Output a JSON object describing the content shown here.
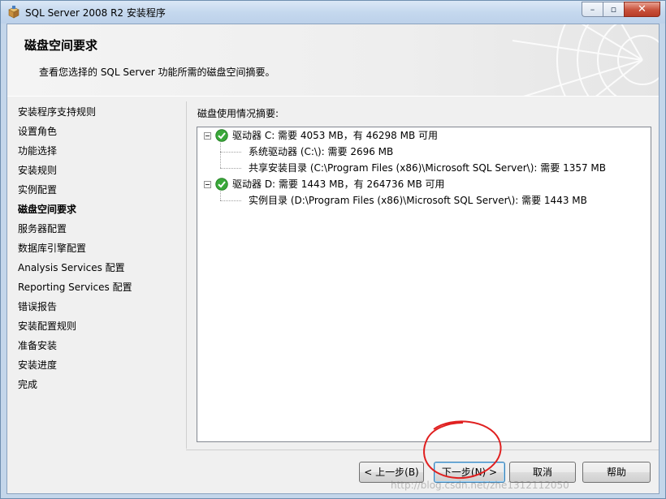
{
  "window": {
    "title": "SQL Server 2008 R2 安装程序",
    "caption_buttons": {
      "minimize": "–",
      "maximize": "▫",
      "close": "✕"
    }
  },
  "header": {
    "title": "磁盘空间要求",
    "subtitle": "查看您选择的 SQL Server 功能所需的磁盘空间摘要。"
  },
  "nav": {
    "items": [
      {
        "label": "安装程序支持规则",
        "active": false
      },
      {
        "label": "设置角色",
        "active": false
      },
      {
        "label": "功能选择",
        "active": false
      },
      {
        "label": "安装规则",
        "active": false
      },
      {
        "label": "实例配置",
        "active": false
      },
      {
        "label": "磁盘空间要求",
        "active": true
      },
      {
        "label": "服务器配置",
        "active": false
      },
      {
        "label": "数据库引擎配置",
        "active": false
      },
      {
        "label": "Analysis Services 配置",
        "active": false
      },
      {
        "label": "Reporting Services 配置",
        "active": false
      },
      {
        "label": "错误报告",
        "active": false
      },
      {
        "label": "安装配置规则",
        "active": false
      },
      {
        "label": "准备安装",
        "active": false
      },
      {
        "label": "安装进度",
        "active": false
      },
      {
        "label": "完成",
        "active": false
      }
    ]
  },
  "content": {
    "summary_label": "磁盘使用情况摘要:",
    "tree": [
      {
        "label": "驱动器 C: 需要 4053 MB，有 46298 MB 可用",
        "status_icon": "check-icon",
        "children": [
          "系统驱动器 (C:\\): 需要 2696 MB",
          "共享安装目录 (C:\\Program Files (x86)\\Microsoft SQL Server\\): 需要 1357 MB"
        ]
      },
      {
        "label": "驱动器 D: 需要 1443 MB，有 264736 MB 可用",
        "status_icon": "check-icon",
        "children": [
          "实例目录 (D:\\Program Files (x86)\\Microsoft SQL Server\\): 需要 1443 MB"
        ]
      }
    ]
  },
  "footer": {
    "back_label": "< 上一步(B)",
    "next_label": "下一步(N) >",
    "cancel_label": "取消",
    "help_label": "帮助"
  },
  "watermark": "http://blog.csdn.net/zhe1312112050",
  "colors": {
    "accent": "#3c7fb1",
    "check_green": "#3aa83a",
    "annotation_red": "#e02020"
  }
}
